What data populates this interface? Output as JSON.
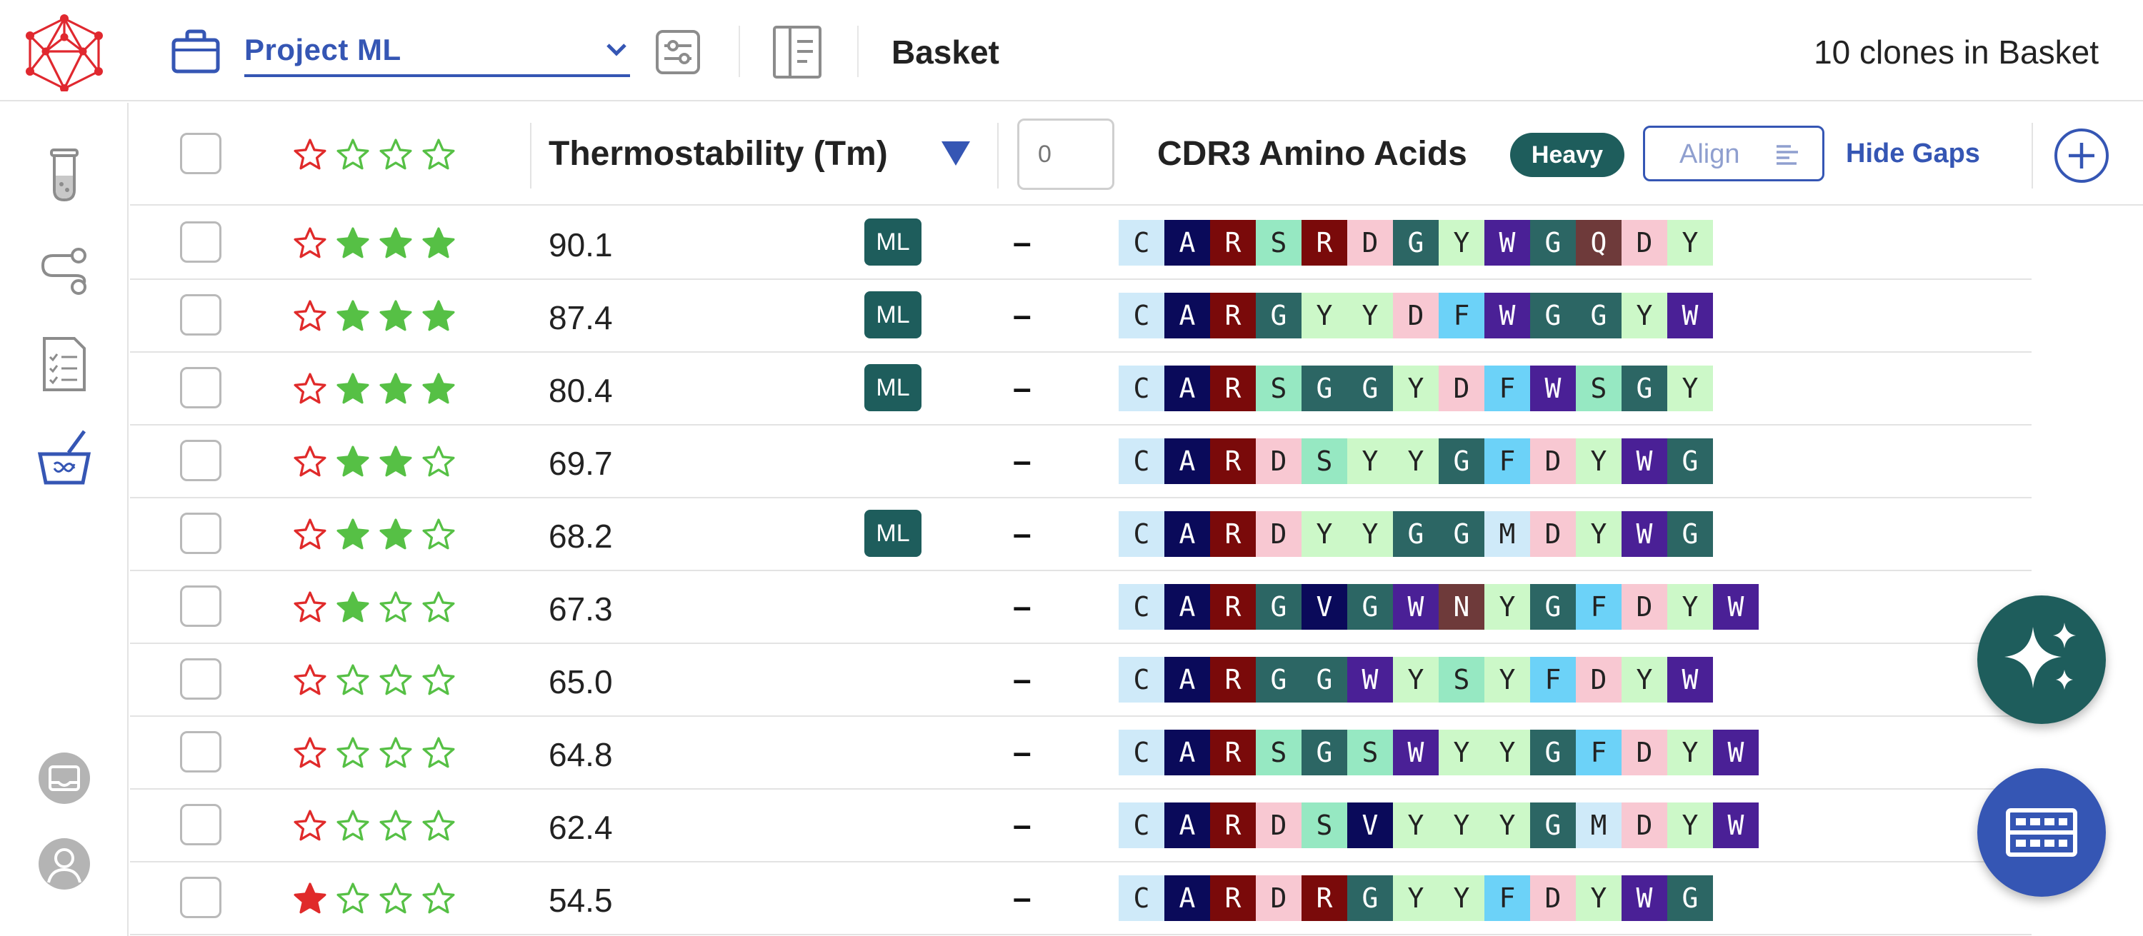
{
  "header": {
    "project": "Project ML",
    "title": "Basket",
    "basket_count": "10 clones in Basket"
  },
  "table": {
    "header": {
      "thermostability": "Thermostability (Tm)",
      "sort_direction": "descending",
      "gap_input_placeholder": "0",
      "cdr3": "CDR3 Amino Acids",
      "chain": "Heavy",
      "align": "Align",
      "hide_gaps": "Hide Gaps"
    },
    "rows": [
      {
        "rating": 0,
        "stars": [
          0,
          1,
          1,
          1
        ],
        "tm": "90.1",
        "ml": true,
        "ml_label": "ML",
        "gap": "–",
        "seq": "CARSRDGYWGQDY"
      },
      {
        "rating": 0,
        "stars": [
          0,
          1,
          1,
          1
        ],
        "tm": "87.4",
        "ml": true,
        "ml_label": "ML",
        "gap": "–",
        "seq": "CARGYYDFWGGYW"
      },
      {
        "rating": 0,
        "stars": [
          0,
          1,
          1,
          1
        ],
        "tm": "80.4",
        "ml": true,
        "ml_label": "ML",
        "gap": "–",
        "seq": "CARSGGYDFWSGY"
      },
      {
        "rating": 0,
        "stars": [
          0,
          1,
          1,
          0
        ],
        "tm": "69.7",
        "ml": false,
        "ml_label": "",
        "gap": "–",
        "seq": "CARDSYYGFDYWG"
      },
      {
        "rating": 0,
        "stars": [
          0,
          1,
          1,
          0
        ],
        "tm": "68.2",
        "ml": true,
        "ml_label": "ML",
        "gap": "–",
        "seq": "CARDYYGGMDYWG"
      },
      {
        "rating": 0,
        "stars": [
          0,
          1,
          0,
          0
        ],
        "tm": "67.3",
        "ml": false,
        "ml_label": "",
        "gap": "–",
        "seq": "CARGVGWNYGFDYW"
      },
      {
        "rating": 0,
        "stars": [
          0,
          0,
          0,
          0
        ],
        "tm": "65.0",
        "ml": false,
        "ml_label": "",
        "gap": "–",
        "seq": "CARGGWYSYFDYW"
      },
      {
        "rating": 0,
        "stars": [
          0,
          0,
          0,
          0
        ],
        "tm": "64.8",
        "ml": false,
        "ml_label": "",
        "gap": "–",
        "seq": "CARSGSWYYGFDYW"
      },
      {
        "rating": 0,
        "stars": [
          0,
          0,
          0,
          0
        ],
        "tm": "62.4",
        "ml": false,
        "ml_label": "",
        "gap": "–",
        "seq": "CARDSVYYYGMDYW"
      },
      {
        "rating": 1,
        "stars": [
          1,
          0,
          0,
          0
        ],
        "tm": "54.5",
        "ml": false,
        "ml_label": "",
        "gap": "–",
        "seq": "CARDRGYYFDYWG"
      }
    ]
  },
  "residue_colors": {
    "C": {
      "bg": "#cfeaf9",
      "fg": "#222222"
    },
    "A": {
      "bg": "#0a0a5a",
      "fg": "#ffffff"
    },
    "R": {
      "bg": "#7a0a0a",
      "fg": "#ffffff"
    },
    "S": {
      "bg": "#96e8c2",
      "fg": "#222222"
    },
    "D": {
      "bg": "#f8c8d2",
      "fg": "#222222"
    },
    "G": {
      "bg": "#2c6664",
      "fg": "#ffffff"
    },
    "Y": {
      "bg": "#ccf8c8",
      "fg": "#222222"
    },
    "W": {
      "bg": "#4a2096",
      "fg": "#ffffff"
    },
    "Q": {
      "bg": "#6e3a3a",
      "fg": "#ffffff"
    },
    "F": {
      "bg": "#6cd2f8",
      "fg": "#222222"
    },
    "M": {
      "bg": "#cfeaf9",
      "fg": "#222222"
    },
    "V": {
      "bg": "#0a0a5a",
      "fg": "#ffffff"
    },
    "N": {
      "bg": "#6e3a3a",
      "fg": "#ffffff"
    }
  },
  "colors": {
    "accent": "#3556b4",
    "teal": "#1e5d5c",
    "star_green": "#56c045",
    "star_red": "#e02a2a"
  },
  "icons": {
    "logo": "network-logo-icon",
    "project": "briefcase-icon",
    "filters": "sliders-icon",
    "panel": "side-panel-icon",
    "sidebar": [
      "test-tube-icon",
      "workflow-icon",
      "checklist-icon",
      "basket-icon",
      "inbox-icon",
      "user-icon"
    ],
    "ai": "sparkle-icon",
    "grid": "table-icon",
    "add": "plus-circle-icon"
  }
}
